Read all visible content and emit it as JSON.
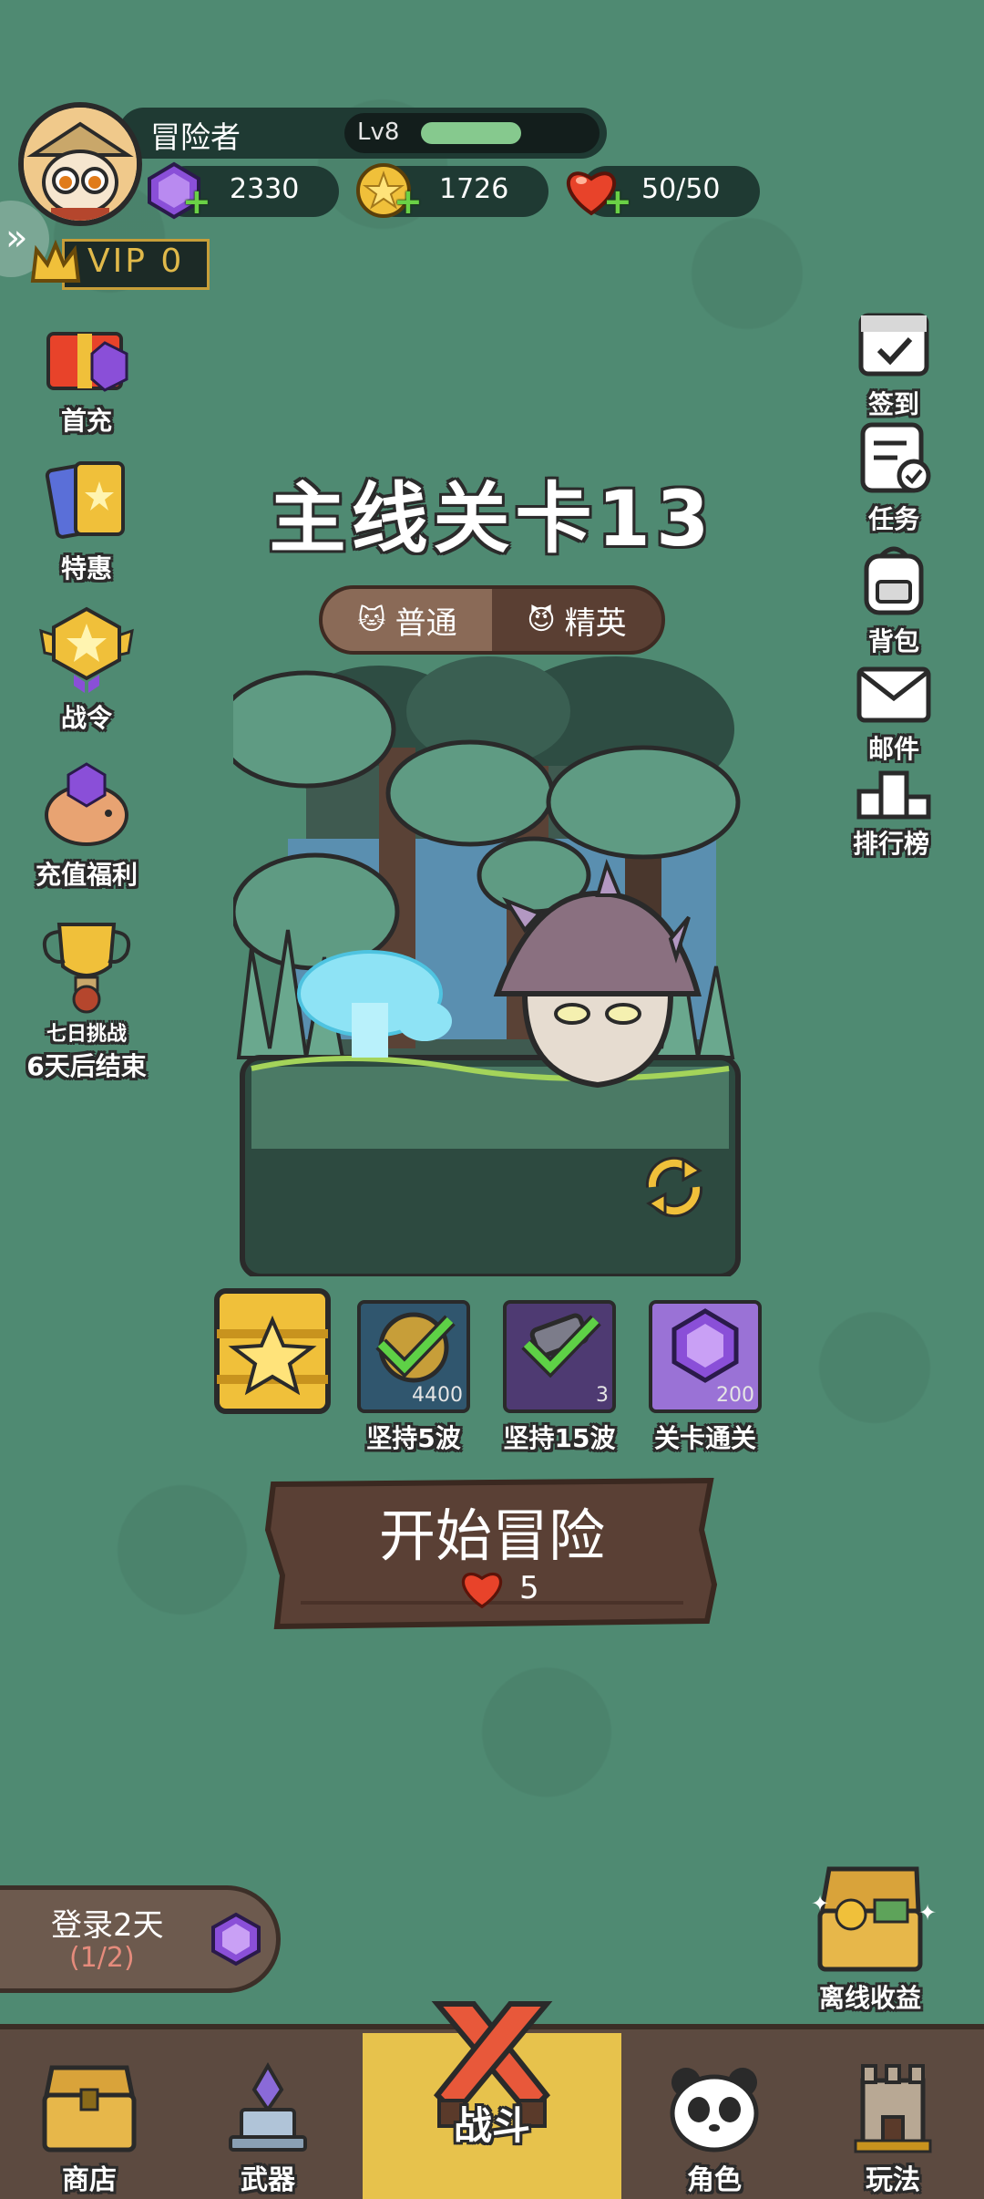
{
  "player": {
    "name": "冒险者",
    "level_label": "Lv8",
    "level_progress": 0.55
  },
  "resources": {
    "gems": "2330",
    "coins": "1726",
    "stamina": "50/50"
  },
  "vip": {
    "label": "VIP 0"
  },
  "left_menu": [
    {
      "label": "首充"
    },
    {
      "label": "特惠"
    },
    {
      "label": "战令"
    },
    {
      "label": "充值福利"
    },
    {
      "label": "七日挑战",
      "sub": "6天后结束"
    }
  ],
  "right_menu": [
    {
      "label": "签到"
    },
    {
      "label": "任务"
    },
    {
      "label": "背包"
    },
    {
      "label": "邮件"
    },
    {
      "label": "排行榜"
    }
  ],
  "stage": {
    "title": "主线关卡13",
    "tabs": [
      {
        "label": "普通",
        "active": true
      },
      {
        "label": "精英",
        "active": false
      }
    ]
  },
  "rewards": [
    {
      "label": "坚持5波",
      "count": "4400"
    },
    {
      "label": "坚持15波",
      "count": "3"
    },
    {
      "label": "关卡通关",
      "count": "200"
    }
  ],
  "start": {
    "label": "开始冒险",
    "cost": "5"
  },
  "login": {
    "title": "登录2天",
    "progress": "(1/2)"
  },
  "offline": {
    "label": "离线收益"
  },
  "bottom_nav": [
    {
      "label": "商店"
    },
    {
      "label": "武器"
    },
    {
      "label": "战斗",
      "active": true
    },
    {
      "label": "角色"
    },
    {
      "label": "玩法"
    }
  ],
  "colors": {
    "background": "#4f8a72",
    "accent_gold": "#e7c24c",
    "wood": "#5c4a40",
    "gem_purple": "#8a4fd8",
    "heart_red": "#e8432a"
  }
}
